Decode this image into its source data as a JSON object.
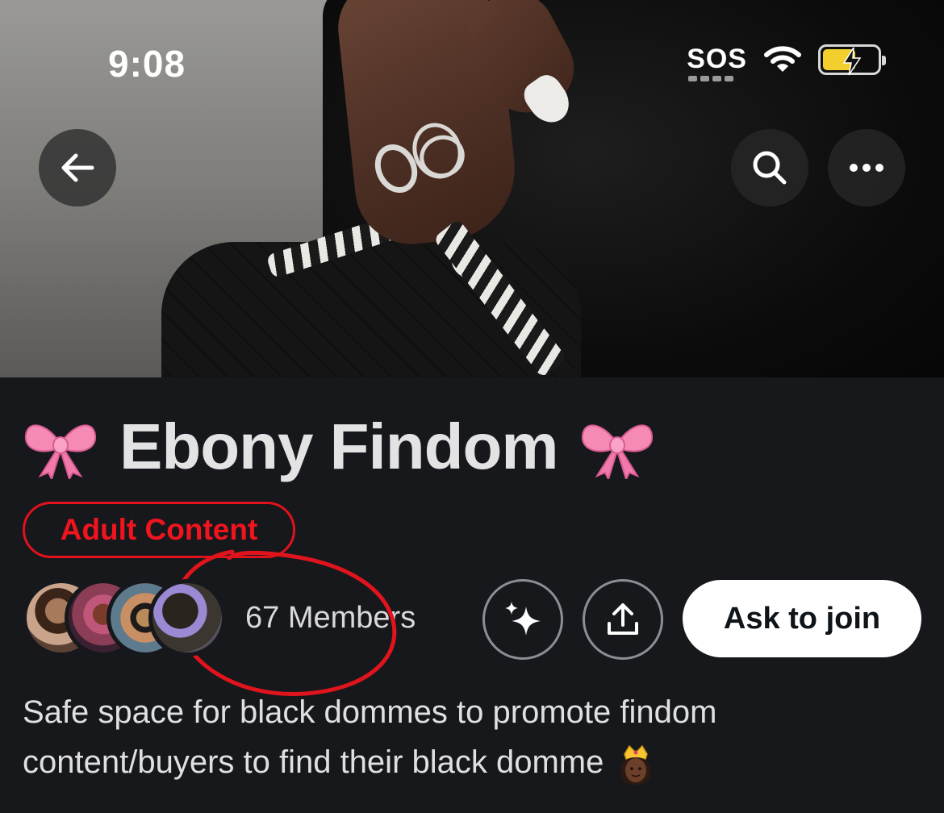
{
  "status_bar": {
    "time": "9:08",
    "carrier_status": "SOS",
    "icons": [
      "wifi-icon",
      "battery-charging-icon"
    ]
  },
  "header": {
    "back_icon": "arrow-left-icon",
    "search_icon": "search-icon",
    "more_icon": "more-horizontal-icon"
  },
  "community": {
    "title": "Ebony Findom",
    "title_decoration": "ribbon-emoji",
    "badge": "Adult Content",
    "members_label": "67 Members",
    "join_label": "Ask to join",
    "description": "Safe space for black dommes to promote findom content/buyers to find their black domme",
    "description_emoji": "princess-emoji"
  },
  "actions": {
    "spark_icon": "sparkle-icon",
    "share_icon": "share-upload-icon"
  },
  "colors": {
    "background": "#16181c",
    "badge_red": "#f0141e",
    "join_bg": "#ffffff",
    "ribbon_pink": "#f58bb5"
  }
}
